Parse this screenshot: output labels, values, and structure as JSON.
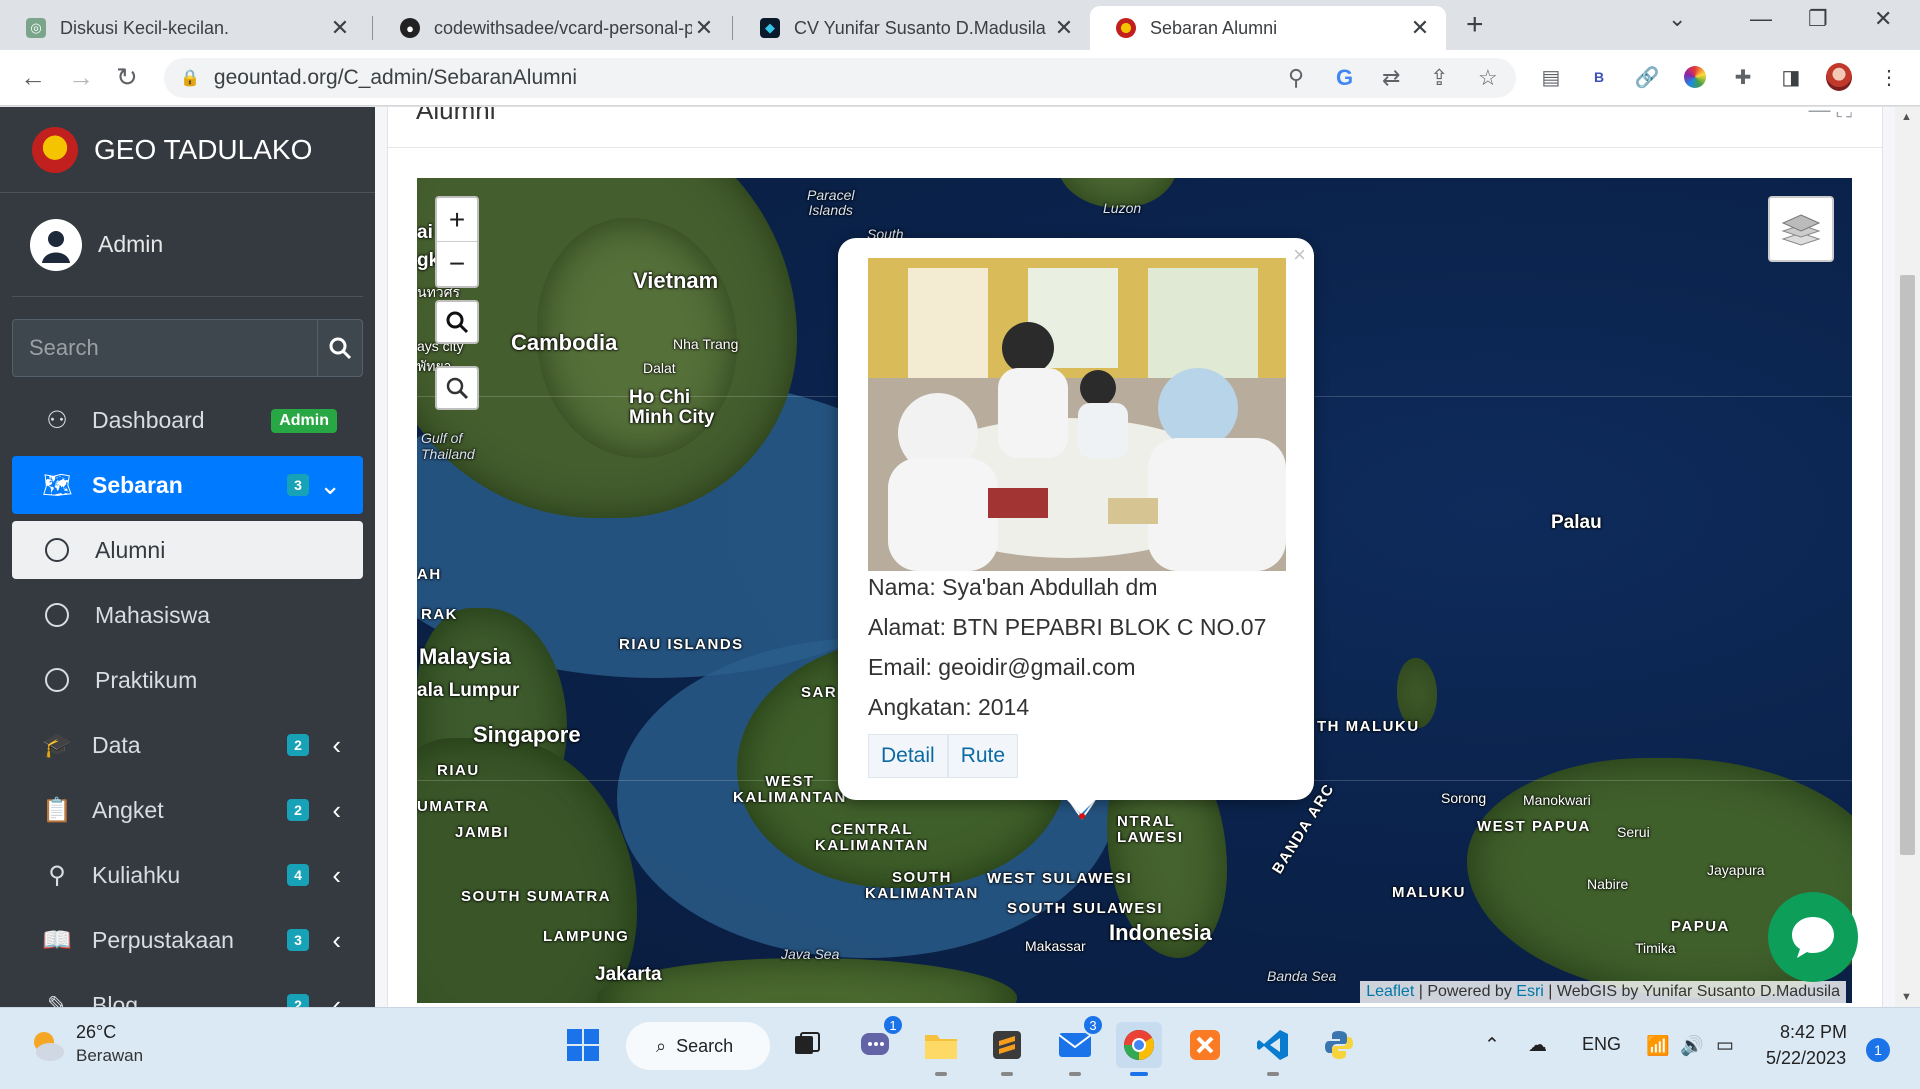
{
  "browser": {
    "tabs": [
      {
        "title": "Diskusi Kecil-kecilan.",
        "close": "✕"
      },
      {
        "title": "codewithsadee/vcard-personal-p",
        "close": "✕"
      },
      {
        "title": "CV Yunifar Susanto D.Madusila",
        "close": "✕"
      },
      {
        "title": "Sebaran Alumni",
        "close": "✕"
      }
    ],
    "new_tab": "+",
    "url": "geountad.org/C_admin/SebaranAlumni",
    "extension_badge": "B"
  },
  "sidebar": {
    "brand": "GEO TADULAKO",
    "user": "Admin",
    "search_placeholder": "Search",
    "items": [
      {
        "label": "Dashboard",
        "badge": "Admin"
      },
      {
        "label": "Sebaran",
        "badge": "3"
      },
      {
        "label": "Alumni"
      },
      {
        "label": "Mahasiswa"
      },
      {
        "label": "Praktikum"
      },
      {
        "label": "Data",
        "badge": "2"
      },
      {
        "label": "Angket",
        "badge": "2"
      },
      {
        "label": "Kuliahku",
        "badge": "4"
      },
      {
        "label": "Perpustakaan",
        "badge": "3"
      },
      {
        "label": "Blog",
        "badge": "2"
      }
    ]
  },
  "card": {
    "title": "Alumni",
    "tools": "—    ⛶"
  },
  "map": {
    "zoom_in": "+",
    "zoom_out": "−",
    "labels": {
      "paracel": "Paracel\nIslands",
      "luzon": "Luzon",
      "south": "South",
      "vietnam": "Vietnam",
      "cambodia": "Cambodia",
      "nha_trang": "Nha Trang",
      "dalat": "Dalat",
      "hcm": "Ho Chi\nMinh City",
      "gulf": "Gulf of\nThailand",
      "palau": "Palau",
      "malaysia": "Malaysia",
      "kl": "ala Lumpur",
      "riau_islands": "RIAU ISLANDS",
      "singapore": "Singapore",
      "riau": "RIAU",
      "sumatra": "UMATRA",
      "jambi": "JAMBI",
      "south_sumatra": "SOUTH SUMATRA",
      "lampung": "LAMPUNG",
      "jakarta": "Jakarta",
      "java_sea": "Java Sea",
      "west_kal": "WEST\nKALIMANTAN",
      "central_kal": "CENTRAL\nKALIMANTAN",
      "south_kal": "SOUTH\nKALIMANTAN",
      "west_sul": "WEST SULAWESI",
      "south_sul": "SOUTH SULAWESI",
      "central_sul": "NTRAL\nLAWESI",
      "makassar": "Makassar",
      "indonesia": "Indonesia",
      "banda_sea": "Banda Sea",
      "banda_arc": "BANDA ARC",
      "maluku": "MALUKU",
      "north_maluku": "TH MALUKU",
      "sorong": "Sorong",
      "manokwari": "Manokwari",
      "west_papua": "WEST PAPUA",
      "serui": "Serui",
      "nabire": "Nabire",
      "jayapura": "Jayapura",
      "papua": "PAPUA",
      "timika": "Timika",
      "sar": "SAR",
      "rak": "RAK",
      "ah": "AH",
      "ai": "ai",
      "gk": "gk",
      "thai1": "นทวศร",
      "thai2": "ays city",
      "thai3": "พัทยา"
    },
    "attribution": {
      "leaflet": "Leaflet",
      "powered": " | Powered by ",
      "esri": "Esri",
      "rest": " | WebGIS by Yunifar Susanto D.Madusila"
    }
  },
  "popup": {
    "close": "×",
    "nama": "Nama: Sya'ban Abdullah dm",
    "alamat": "Alamat: BTN PEPABRI BLOK C NO.07",
    "email": "Email: geoidir@gmail.com",
    "angkatan": "Angkatan: 2014",
    "detail": "Detail",
    "rute": "Rute"
  },
  "taskbar": {
    "temp": "26°C",
    "weather": "Berawan",
    "search": "Search",
    "chat_badge": "1",
    "mail_badge": "3",
    "lang": "ENG",
    "time": "8:42 PM",
    "date": "5/22/2023",
    "notifications": "1"
  },
  "colors": {
    "sidebar_bg": "#343a40",
    "accent": "#007bff",
    "badge_info": "#17a2b8",
    "badge_success": "#28a745"
  }
}
